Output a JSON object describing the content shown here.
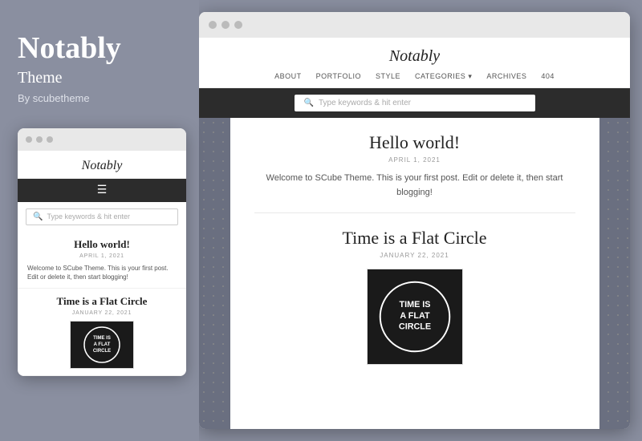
{
  "left": {
    "title": "Notably",
    "subtitle": "Theme",
    "author": "By scubetheme"
  },
  "mobile": {
    "browser_dots": [
      "dot1",
      "dot2",
      "dot3"
    ],
    "site_title": "Notably",
    "search_placeholder": "Type keywords & hit enter",
    "post1": {
      "title": "Hello world!",
      "date": "APRIL 1, 2021",
      "excerpt": "Welcome to SCube Theme. This is your first post. Edit or delete it, then start blogging!"
    },
    "post2": {
      "title": "Time is a Flat Circle",
      "date": "JANUARY 22, 2021"
    }
  },
  "desktop": {
    "browser_dots": [
      "dot1",
      "dot2",
      "dot3"
    ],
    "site_title": "Notably",
    "nav": {
      "items": [
        "ABOUT",
        "PORTFOLIO",
        "STYLE",
        "CATEGORIES",
        "ARCHIVES",
        "404"
      ]
    },
    "search_placeholder": "Type keywords & hit enter",
    "post1": {
      "title": "Hello world!",
      "date": "APRIL 1, 2021",
      "excerpt": "Welcome to SCube Theme. This is your first post. Edit or delete it, then start blogging!"
    },
    "post2": {
      "title": "Time is a Flat Circle",
      "date": "JANUARY 22, 2021",
      "thumbnail_text": "TIME IS A FLAT CIRCLE"
    }
  }
}
